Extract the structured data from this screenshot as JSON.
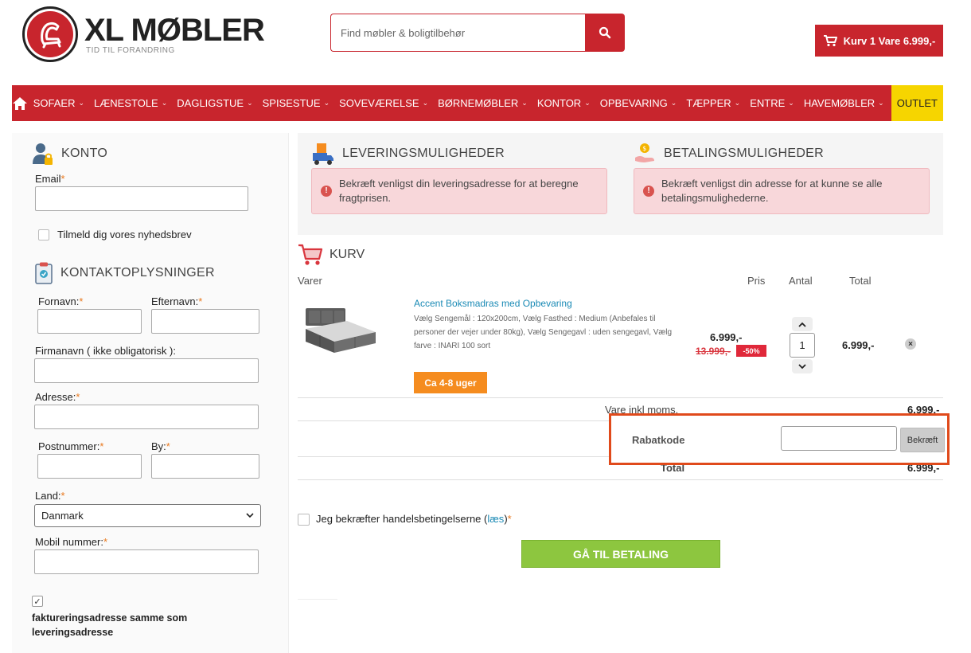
{
  "header": {
    "brand": "XL MØBLER",
    "tagline": "TID TIL FORANDRING",
    "search_placeholder": "Find møbler & boligtilbehør",
    "cart_label": "Kurv 1 Vare 6.999,-"
  },
  "nav": {
    "items": [
      "SOFAER",
      "LÆNESTOLE",
      "DAGLIGSTUE",
      "SPISESTUE",
      "SOVEVÆRELSE",
      "BØRNEMØBLER",
      "KONTOR",
      "OPBEVARING",
      "TÆPPER",
      "ENTRE",
      "HAVEMØBLER"
    ],
    "outlet": "OUTLET",
    "colors": {
      "bar": "#c8252d",
      "outlet": "#f6d500"
    }
  },
  "account": {
    "title": "KONTO",
    "email_label": "Email",
    "newsletter_label": "Tilmeld dig vores nyhedsbrev"
  },
  "contact": {
    "title": "KONTAKTOPLYSNINGER",
    "firstname_label": "Fornavn:",
    "lastname_label": "Efternavn:",
    "company_label": "Firmanavn ( ikke obligatorisk ):",
    "address_label": "Adresse:",
    "postal_label": "Postnummer:",
    "city_label": "By:",
    "country_label": "Land:",
    "country_value": "Danmark",
    "mobile_label": "Mobil nummer:",
    "billing_same_label": "faktureringsadresse samme som leveringsadresse"
  },
  "delivery": {
    "title": "LEVERINGSMULIGHEDER",
    "alert": "Bekræft venligst din leveringsadresse for at beregne fragtprisen."
  },
  "payment": {
    "title": "BETALINGSMULIGHEDER",
    "alert": "Bekræft venligst din adresse for at kunne se alle betalingsmulighederne."
  },
  "cart": {
    "title": "KURV",
    "headers": {
      "items": "Varer",
      "price": "Pris",
      "quantity": "Antal",
      "total": "Total"
    },
    "product": {
      "name": "Accent Boksmadras med Opbevaring",
      "description": "Vælg Sengemål : 120x200cm, Vælg Fasthed : Medium (Anbefales til personer der vejer under 80kg), Vælg Sengegavl : uden sengegavl, Vælg farve : INARI 100 sort",
      "delivery": "Ca 4-8 uger",
      "price": "6.999,-",
      "old_price": "13.999,-",
      "discount": "-50%",
      "quantity": "1",
      "total": "6.999,-"
    },
    "subtotal_label": "Vare inkl moms.",
    "subtotal_value": "6.999,-",
    "coupon_label": "Rabatkode",
    "coupon_button": "Bekræft",
    "total_label": "Total",
    "total_value": "6.999,-",
    "terms_prefix": "Jeg bekræfter handelsbetingelserne (",
    "terms_link": "læs",
    "terms_suffix": ")",
    "checkout_button": "GÅ TIL BETALING"
  }
}
